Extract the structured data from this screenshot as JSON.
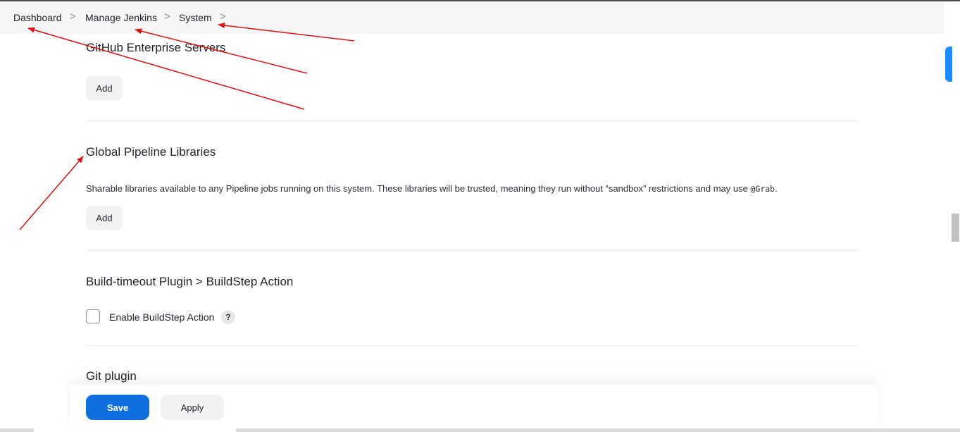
{
  "breadcrumb": {
    "items": [
      {
        "label": "Dashboard"
      },
      {
        "label": "Manage Jenkins"
      },
      {
        "label": "System"
      }
    ],
    "separator": ">"
  },
  "sections": {
    "github_enterprise": {
      "title": "GitHub Enterprise Servers",
      "add_label": "Add"
    },
    "global_pipeline": {
      "title": "Global Pipeline Libraries",
      "description": "Sharable libraries available to any Pipeline jobs running on this system. These libraries will be trusted, meaning they run without “sandbox” restrictions and may use ",
      "description_code": "@Grab",
      "description_end": ".",
      "add_label": "Add"
    },
    "build_timeout": {
      "title": "Build-timeout Plugin > BuildStep Action",
      "checkbox_label": "Enable BuildStep Action",
      "help_label": "?"
    },
    "git_plugin": {
      "title": "Git plugin"
    }
  },
  "actions": {
    "save_label": "Save",
    "apply_label": "Apply"
  },
  "colors": {
    "accent": "#0f6fde",
    "annotation_arrow": "#e01010"
  }
}
